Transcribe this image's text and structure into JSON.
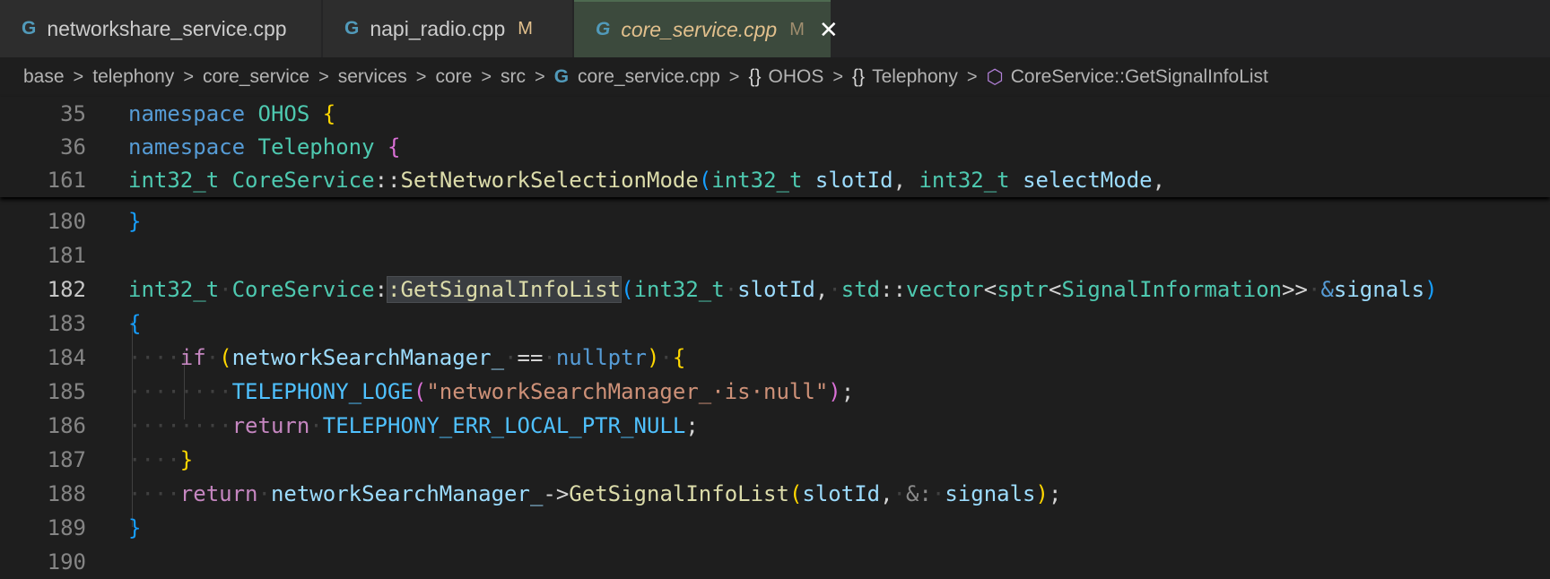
{
  "tabs": [
    {
      "icon": "G",
      "label": "networkshare_service.cpp",
      "modified": "",
      "active": false
    },
    {
      "icon": "G",
      "label": "napi_radio.cpp",
      "modified": "M",
      "active": false
    },
    {
      "icon": "G",
      "label": "core_service.cpp",
      "modified": "M",
      "active": true,
      "close": "✕"
    }
  ],
  "breadcrumb": {
    "sep": ">",
    "parts": [
      "base",
      "telephony",
      "core_service",
      "services",
      "core",
      "src"
    ],
    "file_icon": "G",
    "file": "core_service.cpp",
    "ns_icon": "{}",
    "ns1": "OHOS",
    "ns2": "Telephony",
    "method": "CoreService::GetSignalInfoList"
  },
  "sticky": [
    {
      "num": "35",
      "kw": "namespace",
      "name": "OHOS",
      "brace": "{"
    },
    {
      "num": "36",
      "kw": "namespace",
      "name": "Telephony",
      "brace": "{"
    },
    {
      "num": "161",
      "t1": "int32_t",
      "cls": "CoreService",
      "op": "::",
      "fn": "SetNetworkSelectionMode",
      "open": "(",
      "t2": "int32_t",
      "p1": "slotId",
      "comma": ",",
      "t3": "int32_t",
      "p2": "selectMode",
      "end": ","
    }
  ],
  "lines": {
    "n180": "180",
    "n181": "181",
    "n182": "182",
    "n183": "183",
    "n184": "184",
    "n185": "185",
    "n186": "186",
    "n187": "187",
    "n188": "188",
    "n189": "189",
    "n190": "190",
    "close_brace": "}",
    "open_brace": "{",
    "l182": {
      "t1": "int32_t",
      "cls": "CoreService",
      "op": ":",
      "fn": ":GetSignalInfoList",
      "open": "(",
      "t2": "int32_t",
      "p1": "slotId",
      "comma": ",",
      "std": "std",
      "op2": "::",
      "vec": "vector",
      "lt": "<",
      "sptr": "sptr",
      "lt2": "<",
      "si": "SignalInformation",
      "gt": ">>",
      "amp": "&",
      "p2": "signals",
      "close": ")"
    },
    "l184": {
      "ws": "····",
      "if": "if",
      "open": "(",
      "var": "networkSearchManager_",
      "ws2": "·",
      "eq": "==",
      "ws3": "·",
      "null": "nullptr",
      "close": ")",
      "brace": "{"
    },
    "l185": {
      "ws": "········",
      "mac": "TELEPHONY_LOGE",
      "open": "(",
      "str": "\"networkSearchManager_·is·null\"",
      "close": ")",
      "semi": ";"
    },
    "l186": {
      "ws": "········",
      "ret": "return",
      "ws2": "·",
      "mac": "TELEPHONY_ERR_LOCAL_PTR_NULL",
      "semi": ";"
    },
    "l187": {
      "ws": "····",
      "brace": "}"
    },
    "l188": {
      "ws": "····",
      "ret": "return",
      "ws2": "·",
      "var": "networkSearchManager_",
      "arrow": "->",
      "fn": "GetSignalInfoList",
      "open": "(",
      "p1": "slotId",
      "comma": ",",
      "hint": "&:",
      "p2": "signals",
      "close": ")",
      "semi": ";"
    }
  }
}
